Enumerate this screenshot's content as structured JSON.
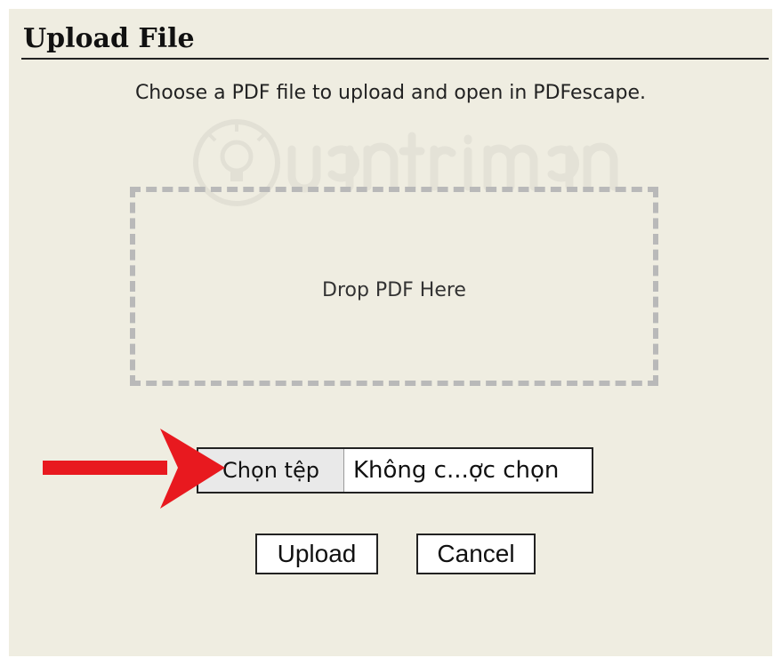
{
  "dialog": {
    "title": "Upload File",
    "instructions": "Choose a PDF file to upload and open in PDFescape.",
    "drop_zone_label": "Drop PDF Here",
    "file_input": {
      "button_label": "Chọn tệp",
      "status": "Không c...ợc chọn"
    },
    "buttons": {
      "upload": "Upload",
      "cancel": "Cancel"
    }
  },
  "overlay": {
    "watermark_icon": "lightbulb-icon",
    "arrow_icon": "red-arrow-icon",
    "arrow_color": "#e8191f"
  },
  "colors": {
    "dialog_background": "#efede1",
    "dropzone_border": "#b9b9b9",
    "text": "#111111"
  }
}
